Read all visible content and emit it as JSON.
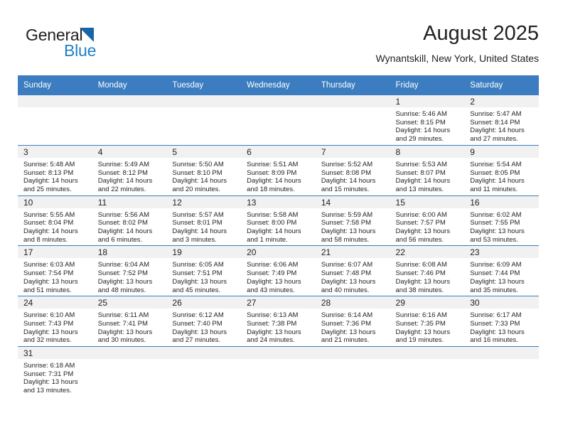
{
  "logo": {
    "word_one": "General",
    "word_two": "Blue",
    "triangle_color": "#1565a8",
    "blue_text_color": "#1f7fc4"
  },
  "header": {
    "title": "August 2025",
    "location": "Wynantskill, New York, United States"
  },
  "theme": {
    "header_bg": "#3b7dc0",
    "daynum_bg": "#f1f1f1",
    "row_divider": "#3b7dc0",
    "text": "#231f20"
  },
  "calendar": {
    "weekday_headers": [
      "Sunday",
      "Monday",
      "Tuesday",
      "Wednesday",
      "Thursday",
      "Friday",
      "Saturday"
    ],
    "weeks": [
      [
        {
          "day": "",
          "blank": true,
          "sunrise": "",
          "sunset": "",
          "daylight_line1": "",
          "daylight_line2": ""
        },
        {
          "day": "",
          "blank": true,
          "sunrise": "",
          "sunset": "",
          "daylight_line1": "",
          "daylight_line2": ""
        },
        {
          "day": "",
          "blank": true,
          "sunrise": "",
          "sunset": "",
          "daylight_line1": "",
          "daylight_line2": ""
        },
        {
          "day": "",
          "blank": true,
          "sunrise": "",
          "sunset": "",
          "daylight_line1": "",
          "daylight_line2": ""
        },
        {
          "day": "",
          "blank": true,
          "sunrise": "",
          "sunset": "",
          "daylight_line1": "",
          "daylight_line2": ""
        },
        {
          "day": "1",
          "blank": false,
          "sunrise": "Sunrise: 5:46 AM",
          "sunset": "Sunset: 8:15 PM",
          "daylight_line1": "Daylight: 14 hours",
          "daylight_line2": "and 29 minutes."
        },
        {
          "day": "2",
          "blank": false,
          "sunrise": "Sunrise: 5:47 AM",
          "sunset": "Sunset: 8:14 PM",
          "daylight_line1": "Daylight: 14 hours",
          "daylight_line2": "and 27 minutes."
        }
      ],
      [
        {
          "day": "3",
          "blank": false,
          "sunrise": "Sunrise: 5:48 AM",
          "sunset": "Sunset: 8:13 PM",
          "daylight_line1": "Daylight: 14 hours",
          "daylight_line2": "and 25 minutes."
        },
        {
          "day": "4",
          "blank": false,
          "sunrise": "Sunrise: 5:49 AM",
          "sunset": "Sunset: 8:12 PM",
          "daylight_line1": "Daylight: 14 hours",
          "daylight_line2": "and 22 minutes."
        },
        {
          "day": "5",
          "blank": false,
          "sunrise": "Sunrise: 5:50 AM",
          "sunset": "Sunset: 8:10 PM",
          "daylight_line1": "Daylight: 14 hours",
          "daylight_line2": "and 20 minutes."
        },
        {
          "day": "6",
          "blank": false,
          "sunrise": "Sunrise: 5:51 AM",
          "sunset": "Sunset: 8:09 PM",
          "daylight_line1": "Daylight: 14 hours",
          "daylight_line2": "and 18 minutes."
        },
        {
          "day": "7",
          "blank": false,
          "sunrise": "Sunrise: 5:52 AM",
          "sunset": "Sunset: 8:08 PM",
          "daylight_line1": "Daylight: 14 hours",
          "daylight_line2": "and 15 minutes."
        },
        {
          "day": "8",
          "blank": false,
          "sunrise": "Sunrise: 5:53 AM",
          "sunset": "Sunset: 8:07 PM",
          "daylight_line1": "Daylight: 14 hours",
          "daylight_line2": "and 13 minutes."
        },
        {
          "day": "9",
          "blank": false,
          "sunrise": "Sunrise: 5:54 AM",
          "sunset": "Sunset: 8:05 PM",
          "daylight_line1": "Daylight: 14 hours",
          "daylight_line2": "and 11 minutes."
        }
      ],
      [
        {
          "day": "10",
          "blank": false,
          "sunrise": "Sunrise: 5:55 AM",
          "sunset": "Sunset: 8:04 PM",
          "daylight_line1": "Daylight: 14 hours",
          "daylight_line2": "and 8 minutes."
        },
        {
          "day": "11",
          "blank": false,
          "sunrise": "Sunrise: 5:56 AM",
          "sunset": "Sunset: 8:02 PM",
          "daylight_line1": "Daylight: 14 hours",
          "daylight_line2": "and 6 minutes."
        },
        {
          "day": "12",
          "blank": false,
          "sunrise": "Sunrise: 5:57 AM",
          "sunset": "Sunset: 8:01 PM",
          "daylight_line1": "Daylight: 14 hours",
          "daylight_line2": "and 3 minutes."
        },
        {
          "day": "13",
          "blank": false,
          "sunrise": "Sunrise: 5:58 AM",
          "sunset": "Sunset: 8:00 PM",
          "daylight_line1": "Daylight: 14 hours",
          "daylight_line2": "and 1 minute."
        },
        {
          "day": "14",
          "blank": false,
          "sunrise": "Sunrise: 5:59 AM",
          "sunset": "Sunset: 7:58 PM",
          "daylight_line1": "Daylight: 13 hours",
          "daylight_line2": "and 58 minutes."
        },
        {
          "day": "15",
          "blank": false,
          "sunrise": "Sunrise: 6:00 AM",
          "sunset": "Sunset: 7:57 PM",
          "daylight_line1": "Daylight: 13 hours",
          "daylight_line2": "and 56 minutes."
        },
        {
          "day": "16",
          "blank": false,
          "sunrise": "Sunrise: 6:02 AM",
          "sunset": "Sunset: 7:55 PM",
          "daylight_line1": "Daylight: 13 hours",
          "daylight_line2": "and 53 minutes."
        }
      ],
      [
        {
          "day": "17",
          "blank": false,
          "sunrise": "Sunrise: 6:03 AM",
          "sunset": "Sunset: 7:54 PM",
          "daylight_line1": "Daylight: 13 hours",
          "daylight_line2": "and 51 minutes."
        },
        {
          "day": "18",
          "blank": false,
          "sunrise": "Sunrise: 6:04 AM",
          "sunset": "Sunset: 7:52 PM",
          "daylight_line1": "Daylight: 13 hours",
          "daylight_line2": "and 48 minutes."
        },
        {
          "day": "19",
          "blank": false,
          "sunrise": "Sunrise: 6:05 AM",
          "sunset": "Sunset: 7:51 PM",
          "daylight_line1": "Daylight: 13 hours",
          "daylight_line2": "and 45 minutes."
        },
        {
          "day": "20",
          "blank": false,
          "sunrise": "Sunrise: 6:06 AM",
          "sunset": "Sunset: 7:49 PM",
          "daylight_line1": "Daylight: 13 hours",
          "daylight_line2": "and 43 minutes."
        },
        {
          "day": "21",
          "blank": false,
          "sunrise": "Sunrise: 6:07 AM",
          "sunset": "Sunset: 7:48 PM",
          "daylight_line1": "Daylight: 13 hours",
          "daylight_line2": "and 40 minutes."
        },
        {
          "day": "22",
          "blank": false,
          "sunrise": "Sunrise: 6:08 AM",
          "sunset": "Sunset: 7:46 PM",
          "daylight_line1": "Daylight: 13 hours",
          "daylight_line2": "and 38 minutes."
        },
        {
          "day": "23",
          "blank": false,
          "sunrise": "Sunrise: 6:09 AM",
          "sunset": "Sunset: 7:44 PM",
          "daylight_line1": "Daylight: 13 hours",
          "daylight_line2": "and 35 minutes."
        }
      ],
      [
        {
          "day": "24",
          "blank": false,
          "sunrise": "Sunrise: 6:10 AM",
          "sunset": "Sunset: 7:43 PM",
          "daylight_line1": "Daylight: 13 hours",
          "daylight_line2": "and 32 minutes."
        },
        {
          "day": "25",
          "blank": false,
          "sunrise": "Sunrise: 6:11 AM",
          "sunset": "Sunset: 7:41 PM",
          "daylight_line1": "Daylight: 13 hours",
          "daylight_line2": "and 30 minutes."
        },
        {
          "day": "26",
          "blank": false,
          "sunrise": "Sunrise: 6:12 AM",
          "sunset": "Sunset: 7:40 PM",
          "daylight_line1": "Daylight: 13 hours",
          "daylight_line2": "and 27 minutes."
        },
        {
          "day": "27",
          "blank": false,
          "sunrise": "Sunrise: 6:13 AM",
          "sunset": "Sunset: 7:38 PM",
          "daylight_line1": "Daylight: 13 hours",
          "daylight_line2": "and 24 minutes."
        },
        {
          "day": "28",
          "blank": false,
          "sunrise": "Sunrise: 6:14 AM",
          "sunset": "Sunset: 7:36 PM",
          "daylight_line1": "Daylight: 13 hours",
          "daylight_line2": "and 21 minutes."
        },
        {
          "day": "29",
          "blank": false,
          "sunrise": "Sunrise: 6:16 AM",
          "sunset": "Sunset: 7:35 PM",
          "daylight_line1": "Daylight: 13 hours",
          "daylight_line2": "and 19 minutes."
        },
        {
          "day": "30",
          "blank": false,
          "sunrise": "Sunrise: 6:17 AM",
          "sunset": "Sunset: 7:33 PM",
          "daylight_line1": "Daylight: 13 hours",
          "daylight_line2": "and 16 minutes."
        }
      ],
      [
        {
          "day": "31",
          "blank": false,
          "sunrise": "Sunrise: 6:18 AM",
          "sunset": "Sunset: 7:31 PM",
          "daylight_line1": "Daylight: 13 hours",
          "daylight_line2": "and 13 minutes."
        },
        {
          "day": "",
          "blank": true,
          "sunrise": "",
          "sunset": "",
          "daylight_line1": "",
          "daylight_line2": ""
        },
        {
          "day": "",
          "blank": true,
          "sunrise": "",
          "sunset": "",
          "daylight_line1": "",
          "daylight_line2": ""
        },
        {
          "day": "",
          "blank": true,
          "sunrise": "",
          "sunset": "",
          "daylight_line1": "",
          "daylight_line2": ""
        },
        {
          "day": "",
          "blank": true,
          "sunrise": "",
          "sunset": "",
          "daylight_line1": "",
          "daylight_line2": ""
        },
        {
          "day": "",
          "blank": true,
          "sunrise": "",
          "sunset": "",
          "daylight_line1": "",
          "daylight_line2": ""
        },
        {
          "day": "",
          "blank": true,
          "sunrise": "",
          "sunset": "",
          "daylight_line1": "",
          "daylight_line2": ""
        }
      ]
    ]
  }
}
